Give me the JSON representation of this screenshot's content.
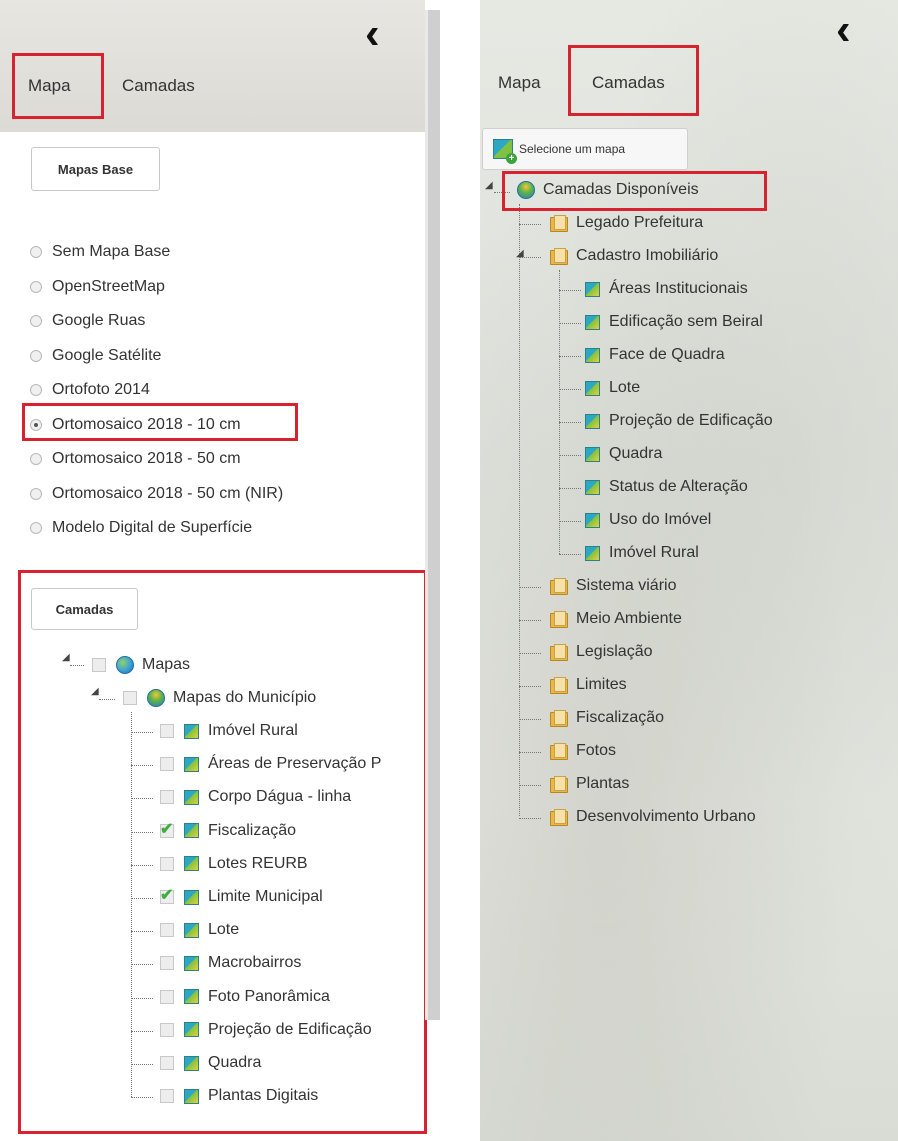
{
  "left": {
    "tabs": [
      {
        "label": "Mapa"
      },
      {
        "label": "Camadas"
      }
    ],
    "back_icon": "chevron-left-icon",
    "basemaps_button": "Mapas Base",
    "basemaps": [
      {
        "label": "Sem Mapa Base",
        "selected": false
      },
      {
        "label": "OpenStreetMap",
        "selected": false
      },
      {
        "label": "Google Ruas",
        "selected": false
      },
      {
        "label": "Google Satélite",
        "selected": false
      },
      {
        "label": "Ortofoto 2014",
        "selected": false
      },
      {
        "label": "Ortomosaico 2018 - 10 cm",
        "selected": true
      },
      {
        "label": "Ortomosaico 2018 - 50 cm",
        "selected": false
      },
      {
        "label": "Ortomosaico 2018 - 50 cm (NIR)",
        "selected": false
      },
      {
        "label": "Modelo Digital de Superfície",
        "selected": false
      }
    ],
    "layers_button": "Camadas",
    "tree": {
      "root": "Mapas",
      "group": "Mapas do Município",
      "items": [
        {
          "label": "Imóvel Rural",
          "checked": false
        },
        {
          "label": "Áreas de Preservação P",
          "checked": false
        },
        {
          "label": "Corpo Dágua - linha",
          "checked": false
        },
        {
          "label": "Fiscalização",
          "checked": true
        },
        {
          "label": "Lotes REURB",
          "checked": false
        },
        {
          "label": "Limite Municipal",
          "checked": true
        },
        {
          "label": "Lote",
          "checked": false
        },
        {
          "label": "Macrobairros",
          "checked": false
        },
        {
          "label": "Foto Panorâmica",
          "checked": false
        },
        {
          "label": "Projeção de Edificação",
          "checked": false
        },
        {
          "label": "Quadra",
          "checked": false
        },
        {
          "label": "Plantas Digitais",
          "checked": false
        }
      ]
    }
  },
  "right": {
    "tabs": [
      {
        "label": "Mapa"
      },
      {
        "label": "Camadas"
      }
    ],
    "back_icon": "chevron-left-icon",
    "select_map_button": "Selecione um mapa",
    "tree": {
      "root": "Camadas Disponíveis",
      "folders_before": [
        "Legado Prefeitura"
      ],
      "open_folder": "Cadastro Imobiliário",
      "open_folder_items": [
        "Áreas Institucionais",
        "Edificação sem Beiral",
        "Face de Quadra",
        "Lote",
        "Projeção de Edificação",
        "Quadra",
        "Status de Alteração",
        "Uso do Imóvel",
        "Imóvel Rural"
      ],
      "folders_after": [
        "Sistema viário",
        "Meio Ambiente",
        "Legislação",
        "Limites",
        "Fiscalização",
        "Fotos",
        "Plantas",
        "Desenvolvimento Urbano"
      ]
    }
  },
  "colors": {
    "highlight": "#d7232f",
    "check": "#3fae3f"
  }
}
